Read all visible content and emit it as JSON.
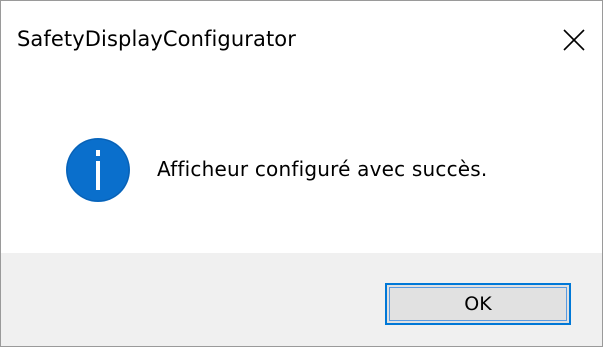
{
  "window": {
    "title": "SafetyDisplayConfigurator"
  },
  "titlebar": {
    "close_icon": "close-icon"
  },
  "message": {
    "icon": "info-icon",
    "text": "Afficheur configuré avec succès."
  },
  "footer": {
    "ok_label": "OK"
  },
  "colors": {
    "info_icon": "#0a6fcc",
    "button_border": "#0078d7",
    "button_bg": "#e1e1e1",
    "footer_bg": "#f0f0f0"
  }
}
